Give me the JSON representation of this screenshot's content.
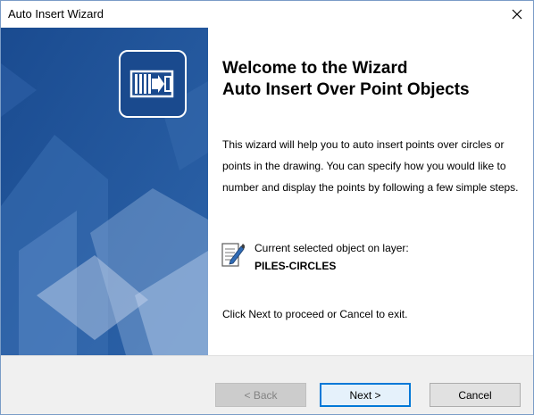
{
  "window": {
    "title": "Auto Insert Wizard",
    "close_glyph": "×"
  },
  "content": {
    "heading_line1": "Welcome to the Wizard",
    "heading_line2": "Auto Insert Over Point Objects",
    "description": "This wizard will help you to auto insert points over circles or points in the drawing. You can specify how you would like to number and display the points by following a few simple steps.",
    "layer_label": "Current selected object on layer:",
    "layer_value": "PILES-CIRCLES",
    "footer": "Click Next to proceed or Cancel to exit."
  },
  "buttons": {
    "back": "< Back",
    "next": "Next >",
    "cancel": "Cancel"
  },
  "colors": {
    "banner": "#1f4f95",
    "default_button_border": "#0078d7"
  },
  "icons": {
    "banner_logo": "wizard-logo-icon",
    "layer": "document-pencil-icon",
    "close": "close-icon"
  }
}
